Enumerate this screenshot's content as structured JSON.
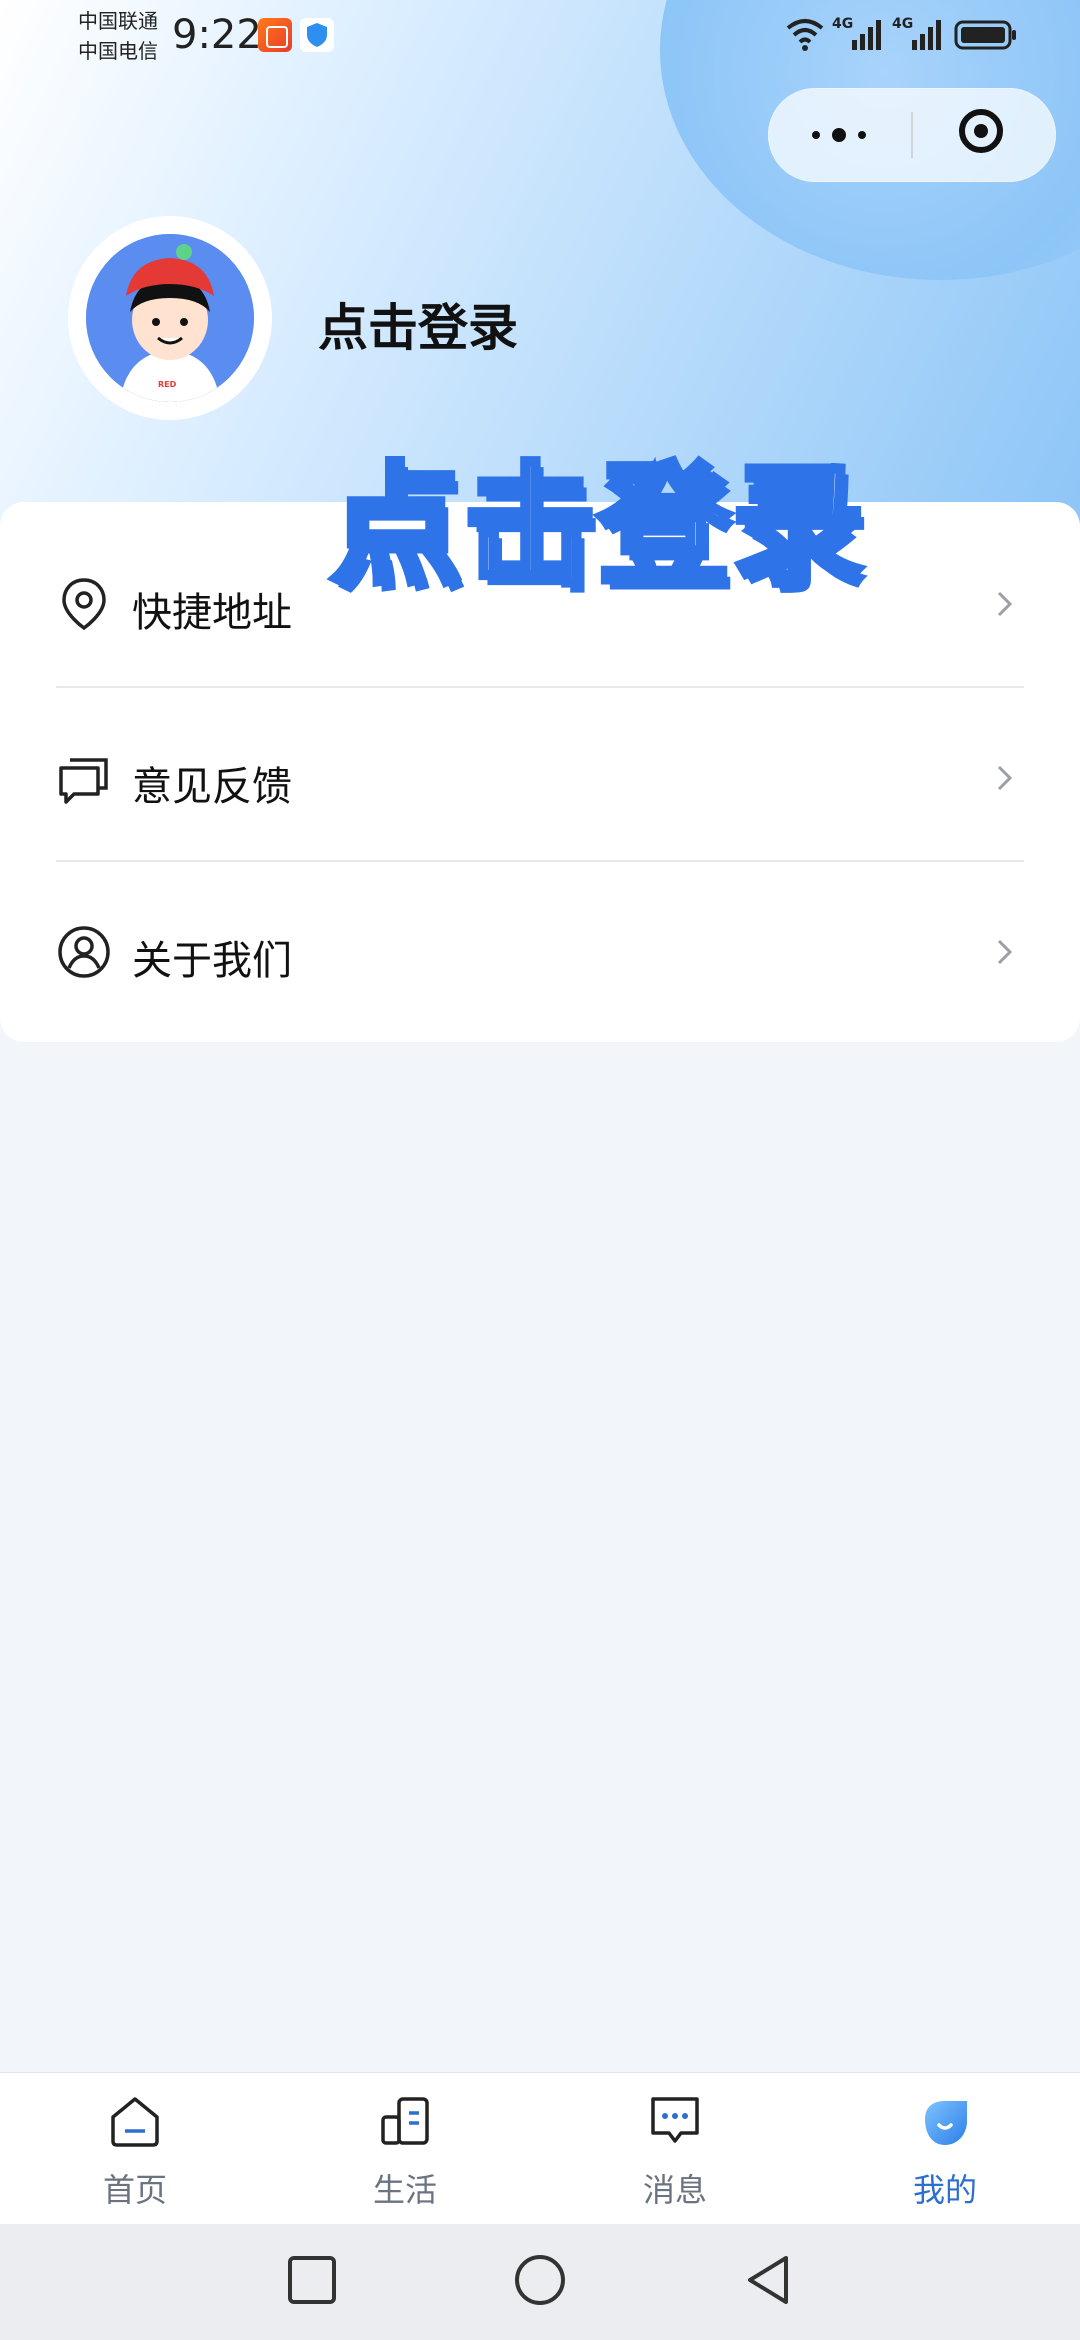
{
  "status_bar": {
    "carrier_1": "中国联通",
    "carrier_2": "中国电信",
    "time": "9:22",
    "network_1": "4G",
    "network_2": "4G"
  },
  "profile": {
    "login_text": "点击登录",
    "avatar_badge": "RED"
  },
  "overlay": {
    "title": "点击登录"
  },
  "menu": {
    "items": [
      {
        "label": "快捷地址",
        "icon": "location-pin-icon"
      },
      {
        "label": "意见反馈",
        "icon": "feedback-chat-icon"
      },
      {
        "label": "关于我们",
        "icon": "user-circle-icon"
      }
    ]
  },
  "tabbar": {
    "tabs": [
      {
        "label": "首页",
        "icon": "home-icon",
        "active": false
      },
      {
        "label": "生活",
        "icon": "life-apps-icon",
        "active": false
      },
      {
        "label": "消息",
        "icon": "message-icon",
        "active": false
      },
      {
        "label": "我的",
        "icon": "profile-smile-icon",
        "active": true
      }
    ]
  },
  "colors": {
    "accent": "#2d6fd0",
    "overlay_stroke": "#2f73e8",
    "page_bg": "#f2f5f9"
  }
}
